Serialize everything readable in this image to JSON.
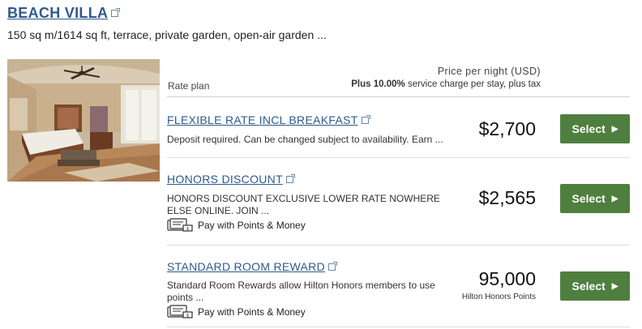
{
  "room": {
    "title": "BEACH VILLA",
    "description": "150 sq m/1614 sq ft, terrace, private garden, open-air garden ..."
  },
  "header": {
    "rate_plan_label": "Rate plan",
    "price_label": "Price per night (USD)",
    "charge_prefix": "Plus 10.00%",
    "charge_suffix": " service charge per stay, plus tax"
  },
  "rates": [
    {
      "name": "FLEXIBLE RATE INCL BREAKFAST",
      "description": "Deposit required. Can be changed subject to availability. Earn ...",
      "price": "$2,700",
      "select_label": "Select"
    },
    {
      "name": "HONORS DISCOUNT",
      "description": "HONORS DISCOUNT EXCLUSIVE LOWER RATE NOWHERE ELSE ONLINE. JOIN ...",
      "pay_option": "Pay with Points & Money",
      "price": "$2,565",
      "select_label": "Select"
    },
    {
      "name": "STANDARD ROOM REWARD",
      "description": "Standard Room Rewards allow Hilton Honors members to use points ...",
      "pay_option": "Pay with Points & Money",
      "price": "95,000",
      "price_unit": "Hilton Honors Points",
      "select_label": "Select"
    }
  ],
  "colors": {
    "link": "#2e5a8c",
    "button": "#4f7f3f"
  },
  "icons": [
    "external-link-icon",
    "chevron-right-icon",
    "points-money-icon"
  ]
}
